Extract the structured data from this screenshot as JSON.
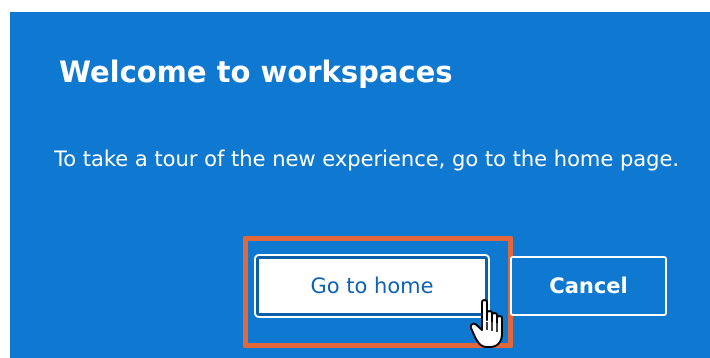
{
  "dialog": {
    "title": "Welcome to workspaces",
    "message": "To take a tour of the new experience, go to the home page.",
    "primary_button_label": "Go to home",
    "secondary_button_label": "Cancel"
  },
  "colors": {
    "dialog_background": "#0f78d1",
    "highlight_border": "#e2673a",
    "text": "#ffffff"
  },
  "icons": {
    "cursor": "hand-pointer-icon"
  }
}
